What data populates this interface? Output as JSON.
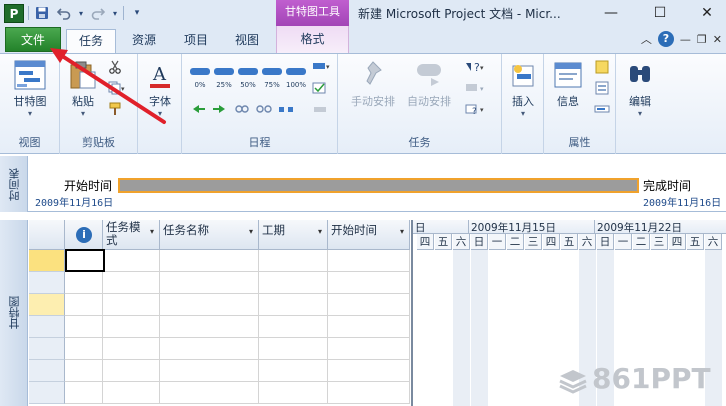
{
  "titlebar": {
    "app_letter": "P",
    "context_tool": "甘特图工具",
    "doc_title": "新建 Microsoft Project 文档 - Micr...",
    "minimize": "—",
    "maximize": "☐",
    "close": "✕"
  },
  "tabs": {
    "file": "文件",
    "items": [
      "任务",
      "资源",
      "项目",
      "视图"
    ],
    "context": "格式"
  },
  "ribbon": {
    "view": {
      "gantt": "甘特图",
      "label": "视图"
    },
    "clipboard": {
      "paste": "粘贴",
      "label": "剪贴板"
    },
    "font": {
      "font": "字体"
    },
    "schedule": {
      "percents": [
        "0%",
        "25%",
        "50%",
        "75%",
        "100%"
      ],
      "label": "日程"
    },
    "tasks": {
      "manual": "手动安排",
      "auto": "自动安排",
      "label": "任务"
    },
    "insert": {
      "insert": "插入"
    },
    "properties": {
      "info": "信息",
      "label": "属性"
    },
    "editing": {
      "edit": "编辑"
    }
  },
  "timeline": {
    "side_label": "时间表",
    "start_label": "开始时间",
    "finish_label": "完成时间",
    "start_date": "2009年11月16日",
    "finish_date": "2009年11月16日"
  },
  "gantt": {
    "side_label": "甘特图",
    "columns": [
      "任务模\n式",
      "任务名称",
      "工期",
      "开始时间"
    ],
    "info_icon": "i",
    "weeks": [
      "日",
      "2009年11月15日",
      "2009年11月22日"
    ],
    "days": [
      "四",
      "五",
      "六",
      "日",
      "一",
      "二",
      "三",
      "四",
      "五",
      "六",
      "日",
      "一",
      "二",
      "三",
      "四",
      "五",
      "六"
    ]
  },
  "watermark": "861PPT",
  "colors": {
    "file_tab": "#23822a",
    "context_tab": "#a245b6",
    "timeline_bar": "#9c9c9c",
    "timeline_border": "#f0a22c",
    "selected_row": "#fbe17f",
    "arrow": "#e0202a"
  }
}
